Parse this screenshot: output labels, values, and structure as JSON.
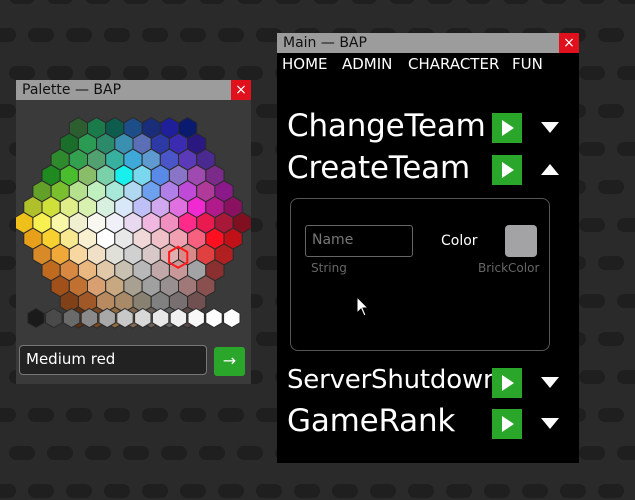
{
  "palette": {
    "title": "Palette — BAP",
    "close_label": "×",
    "color_input_value": "Medium red",
    "go_label": "→"
  },
  "main": {
    "title": "Main — BAP",
    "close_label": "×",
    "menu": [
      "HOME",
      "ADMIN",
      "CHARACTER",
      "FUN"
    ],
    "commands": [
      {
        "name": "ChangeTeam",
        "expanded": false
      },
      {
        "name": "CreateTeam",
        "expanded": true
      },
      {
        "name": "ServerShutdown",
        "expanded": false
      },
      {
        "name": "GameRank",
        "expanded": false
      }
    ],
    "create_team": {
      "name_placeholder": "Name",
      "name_type": "String",
      "color_label": "Color",
      "color_type": "BrickColor",
      "color_value": "#a3a2a5"
    }
  },
  "colors": {
    "accent_green": "#2aa72a",
    "close_red": "#e0101c",
    "titlebar_gray": "#9c9c9c"
  }
}
